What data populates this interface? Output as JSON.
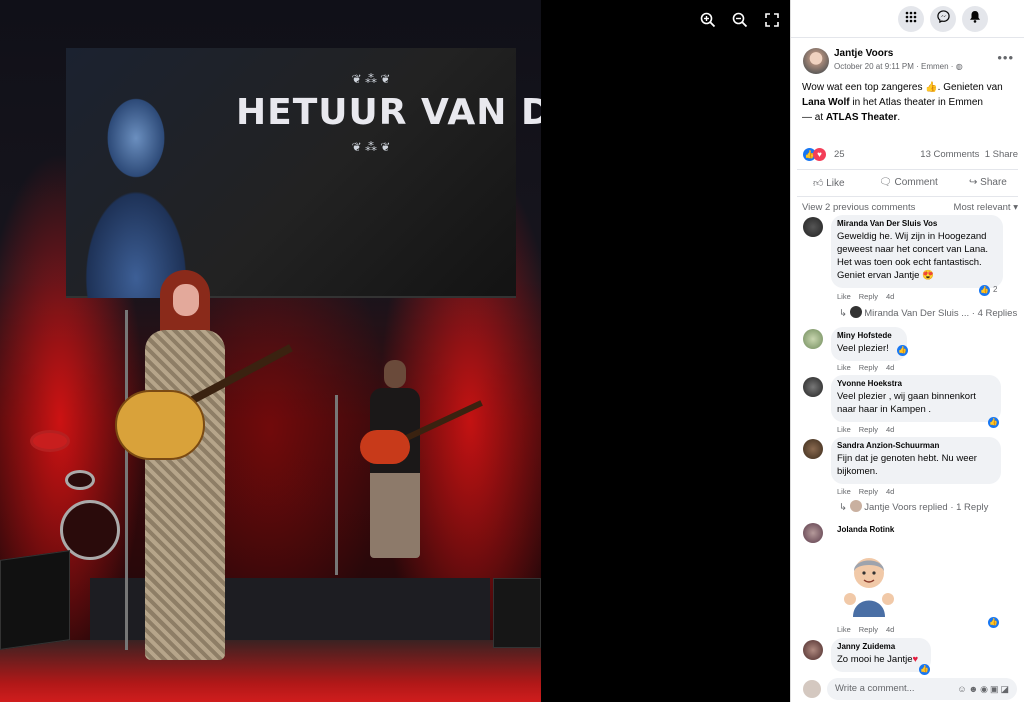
{
  "viewer": {
    "zoom_in_icon": "zoom-in-icon",
    "zoom_out_icon": "zoom-out-icon",
    "fullscreen_icon": "fullscreen-icon",
    "screen_logo": "HETUUR VAN DE WOLF"
  },
  "topbar": {
    "icons": [
      "menu-grid-icon",
      "messenger-icon",
      "bell-icon"
    ]
  },
  "post": {
    "author": "Jantje Voors",
    "meta": "October 20 at 9:11 PM · Emmen · ",
    "text_prefix": "Wow wat een top zangeres ",
    "text_mid": ". Genieten van ",
    "artist": "Lana Wolf",
    "text_suffix": " in het Atlas theater in Emmen",
    "at_prefix": "— at ",
    "place": "ATLAS Theater",
    "at_suffix": "."
  },
  "reactions": {
    "count": "25",
    "comments": "13 Comments",
    "shares": "1 Share"
  },
  "actions": {
    "like": "Like",
    "comment": "Comment",
    "share": "Share"
  },
  "comments_header": {
    "view_previous": "View 2 previous comments",
    "sort": "Most relevant"
  },
  "comments": [
    {
      "name": "Miranda Van Der Sluis Vos",
      "lines": [
        "Geweldig he. Wij zijn in Hoogezand",
        "geweest naar het concert van Lana.",
        "Het was toen ook echt fantastisch.",
        "Geniet ervan Jantje"
      ],
      "like": "Like",
      "reply": "Reply",
      "time": "4d",
      "reaction_count": "2",
      "replies_text": "Miranda Van Der Sluis ... · 4 Replies"
    },
    {
      "name": "Miny Hofstede",
      "lines": [
        "Veel plezier!"
      ],
      "like": "Like",
      "reply": "Reply",
      "time": "4d"
    },
    {
      "name": "Yvonne Hoekstra",
      "lines": [
        "Veel plezier , wij gaan binnenkort",
        "naar haar in Kampen ."
      ],
      "like": "Like",
      "reply": "Reply",
      "time": "4d"
    },
    {
      "name": "Sandra Anzion-Schuurman",
      "lines": [
        "Fijn dat je genoten hebt. Nu weer",
        "bijkomen."
      ],
      "like": "Like",
      "reply": "Reply",
      "time": "4d",
      "replies_text": "Jantje Voors replied · 1 Reply"
    },
    {
      "name": "Jolanda Rotink",
      "lines": [],
      "like": "Like",
      "reply": "Reply",
      "time": "4d"
    },
    {
      "name": "Janny Zuidema",
      "lines": [
        "Zo mooi he Jantje"
      ]
    }
  ],
  "write_comment": {
    "placeholder": "Write a comment..."
  }
}
